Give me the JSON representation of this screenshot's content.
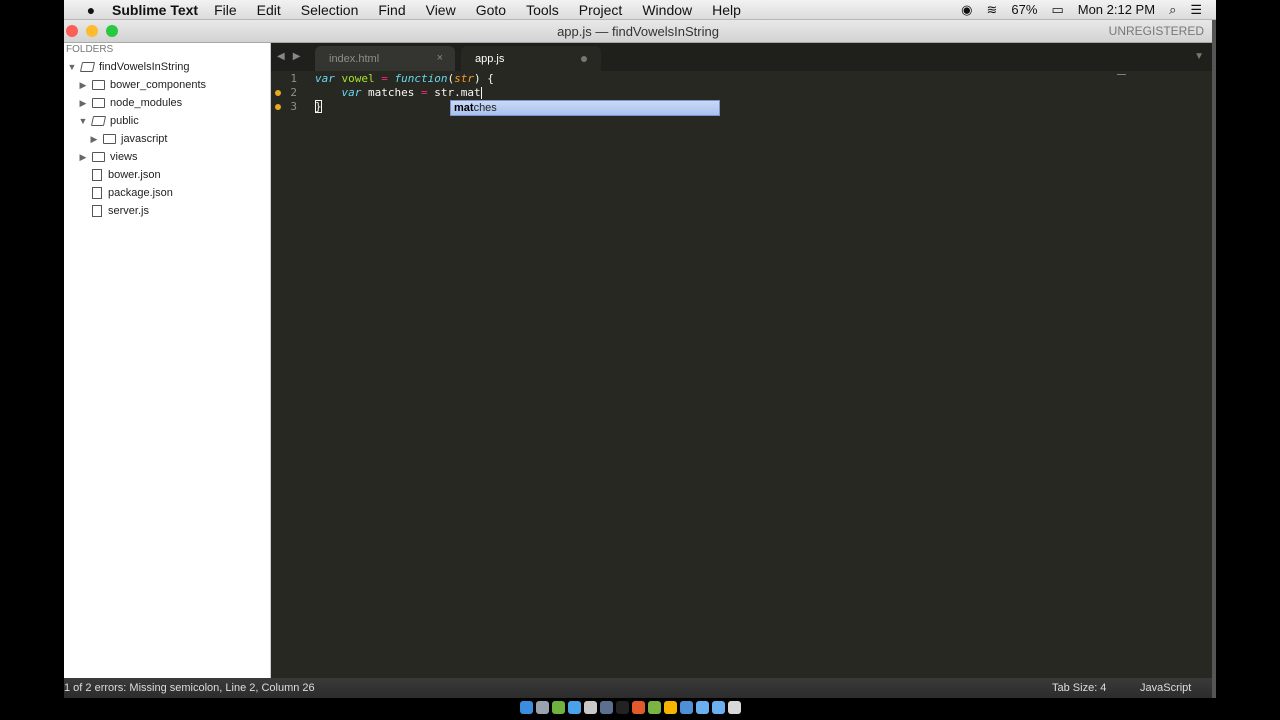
{
  "menubar": {
    "apple": "",
    "app_name": "Sublime Text",
    "items": [
      "File",
      "Edit",
      "Selection",
      "Find",
      "View",
      "Goto",
      "Tools",
      "Project",
      "Window",
      "Help"
    ],
    "battery": "67%",
    "clock": "Mon 2:12 PM"
  },
  "window": {
    "title": "app.js — findVowelsInString",
    "unregistered": "UNREGISTERED"
  },
  "sidebar": {
    "header": "FOLDERS",
    "root": "findVowelsInString",
    "items": [
      {
        "label": "bower_components"
      },
      {
        "label": "node_modules"
      },
      {
        "label": "public"
      },
      {
        "label": "javascript"
      },
      {
        "label": "views"
      },
      {
        "label": "bower.json"
      },
      {
        "label": "package.json"
      },
      {
        "label": "server.js"
      }
    ]
  },
  "tabs": [
    {
      "label": "index.html",
      "close": "×"
    },
    {
      "label": "app.js"
    }
  ],
  "code": {
    "line_numbers": [
      "1",
      "2",
      "3"
    ],
    "l1": {
      "kw1": "var",
      "name": "vowel",
      "op": "=",
      "kw2": "function",
      "open": "(",
      "param": "str",
      "close": ") {"
    },
    "l2": {
      "kw": "var",
      "name": "matches",
      "op": "=",
      "rest": "str.mat"
    },
    "l3": {
      "brace": "}"
    }
  },
  "autocomplete": {
    "match": "mat",
    "rest": "ches"
  },
  "status": {
    "message": "1 of 2 errors: Missing semicolon, Line 2, Column 26",
    "tab_size": "Tab Size: 4",
    "syntax": "JavaScript"
  }
}
